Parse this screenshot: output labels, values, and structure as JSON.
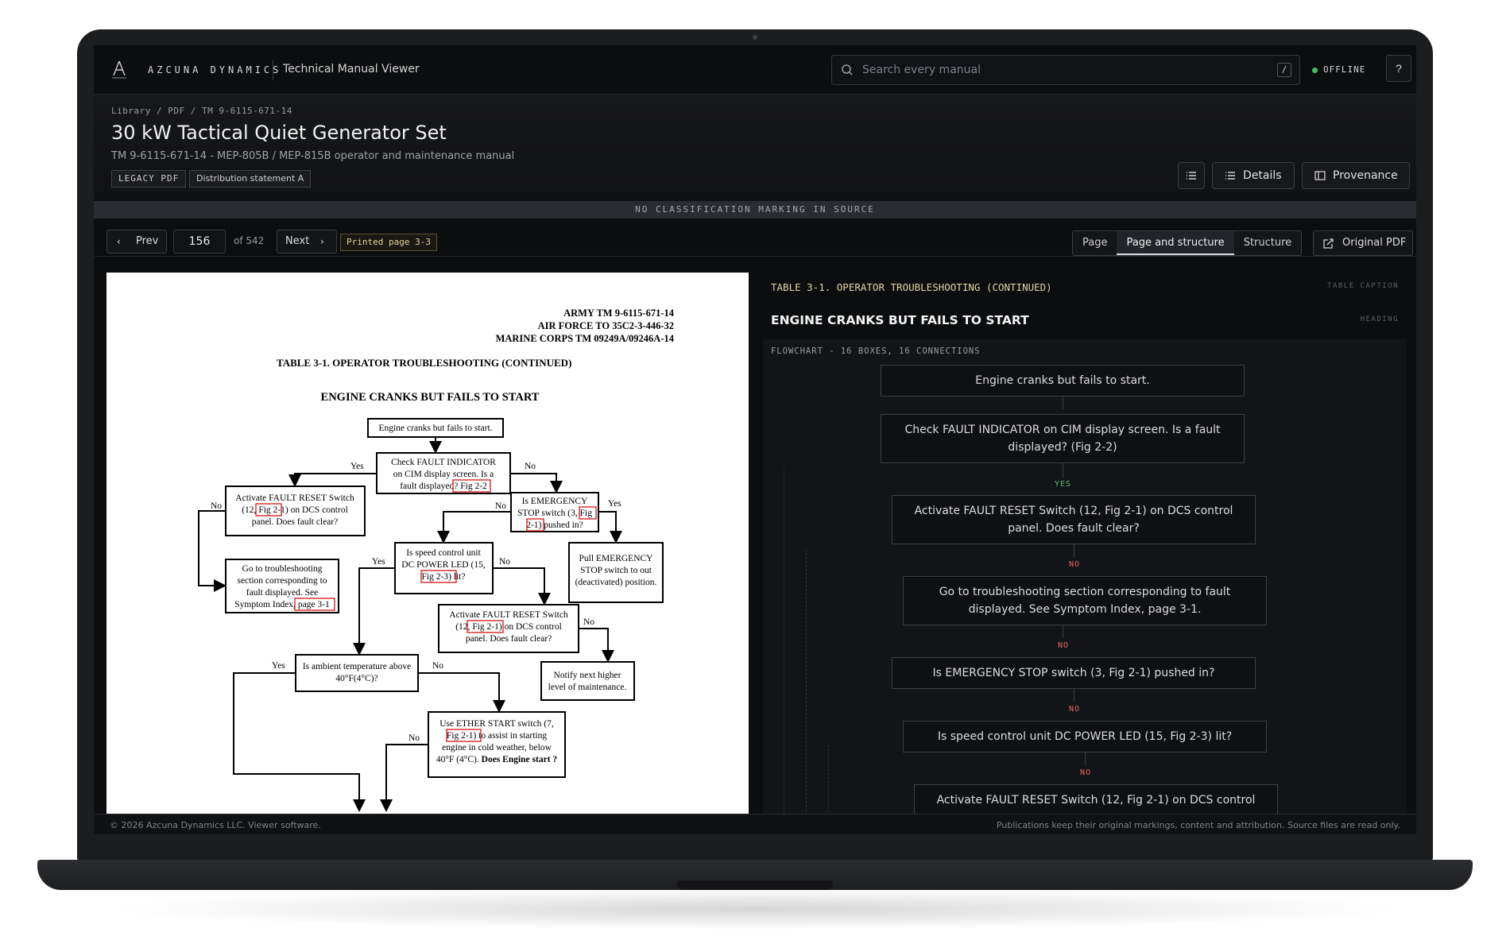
{
  "app": {
    "brand": "AZCUNA DYNAMICS",
    "title": "Technical Manual Viewer",
    "status": "OFFLINE",
    "status_color": "#3bbf6a",
    "help": "?"
  },
  "search": {
    "placeholder": "Search every manual",
    "shortcut": "/"
  },
  "breadcrumb": "Library / PDF / TM 9-6115-671-14",
  "doc": {
    "title": "30 kW Tactical Quiet Generator Set",
    "subtitle": "TM 9-6115-671-14 - MEP-805B / MEP-815B operator and maintenance manual",
    "tags": [
      "LEGACY PDF",
      "Distribution statement A"
    ]
  },
  "actions": {
    "details": "Details",
    "provenance": "Provenance"
  },
  "classification": "NO CLASSIFICATION MARKING IN SOURCE",
  "nav": {
    "prev": "Prev",
    "page": "156",
    "of": "of 542",
    "next": "Next",
    "printed": "Printed page 3-3",
    "modes": [
      "Page",
      "Page and structure",
      "Structure"
    ],
    "active_mode": "Page and structure",
    "original": "Original PDF"
  },
  "pdf": {
    "header": [
      "ARMY TM 9-6115-671-14",
      "AIR FORCE TO 35C2-3-446-32",
      "MARINE CORPS TM 09249A/09246A-14"
    ],
    "caption": "TABLE 3-1.  OPERATOR TROUBLESHOOTING (CONTINUED)",
    "heading": "ENGINE CRANKS BUT FAILS TO START",
    "b1": "Engine cranks but fails to start.",
    "b2": [
      "Check FAULT INDICATOR",
      "on CIM display screen.  Is a",
      "fault displayed? ",
      "Fig 2-2"
    ],
    "b3": [
      "Activate FAULT RESET Switch",
      "(12, ",
      "Fig 2-1",
      ") on DCS control",
      "panel. Does fault clear?"
    ],
    "b4": [
      "Is EMERGENCY",
      "STOP switch (3, ",
      "Fig",
      "2-1",
      ") pushed in?"
    ],
    "b5": [
      "Go to troubleshooting",
      "section corresponding to",
      "fault displayed. See",
      "Symptom Index, ",
      "page 3-1"
    ],
    "b6": [
      "Is speed control unit",
      "DC POWER LED (15,",
      "Fig 2-3",
      ") lit?"
    ],
    "b7": [
      "Pull EMERGENCY",
      "STOP switch to out",
      "(deactivated) position."
    ],
    "b8": [
      "Activate FAULT RESET Switch",
      "(12, ",
      "Fig 2-1",
      ") on DCS control",
      "panel. Does fault clear?"
    ],
    "b9": [
      "Is ambient temperature above",
      "40°F(4°C)?"
    ],
    "b10": [
      "Notify next higher",
      "level of maintenance."
    ],
    "b11": [
      "Use ETHER START switch (7,",
      "Fig 2-1",
      ") to assist in starting",
      "engine in cold weather, below",
      "40°F (4°C). ",
      "Does Engine start ?"
    ],
    "yes": "Yes",
    "no": "No"
  },
  "structure": {
    "caption": "TABLE 3-1. OPERATOR TROUBLESHOOTING (CONTINUED)",
    "caption_kind": "TABLE CAPTION",
    "heading": "ENGINE CRANKS BUT FAILS TO START",
    "heading_kind": "HEADING",
    "flow_label": "FLOWCHART - 16 BOXES, 16 CONNECTIONS",
    "boxes": [
      "Engine cranks but fails to start.",
      "Check FAULT INDICATOR on CIM display screen. Is a fault displayed? (Fig 2-2)",
      "Activate FAULT RESET Switch (12, Fig 2-1) on DCS control panel. Does fault clear?",
      "Go to troubleshooting section corresponding to fault displayed. See Symptom Index, page 3-1.",
      "Is EMERGENCY STOP switch (3, Fig 2-1) pushed in?",
      "Is speed control unit DC POWER LED (15, Fig 2-3) lit?",
      "Activate FAULT RESET Switch (12, Fig 2-1) on DCS control"
    ],
    "edges": [
      "YES",
      "NO",
      "NO",
      "NO",
      "NO"
    ]
  },
  "footer": {
    "left": "© 2026 Azcuna Dynamics LLC. Viewer software.",
    "right": "Publications keep their original markings, content and attribution. Source files are read only."
  }
}
